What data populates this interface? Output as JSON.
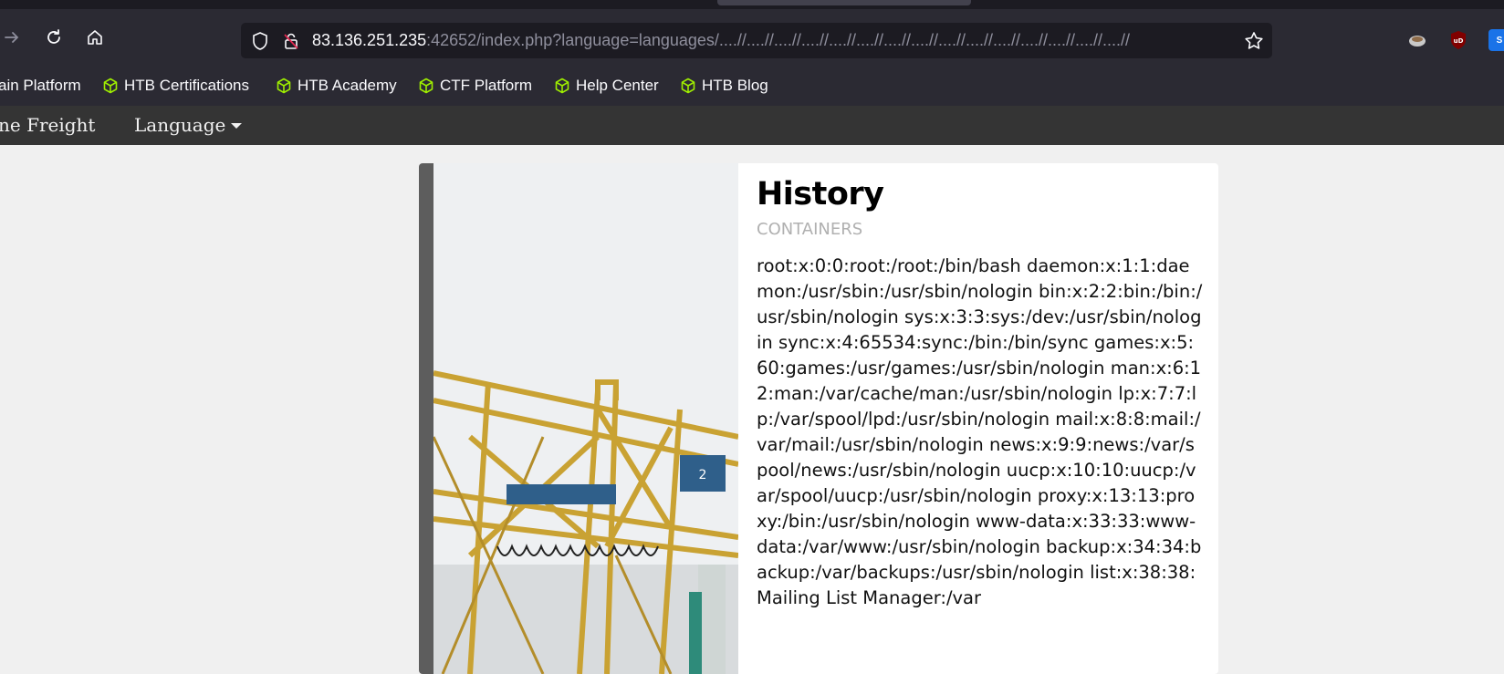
{
  "browser": {
    "url_host": "83.136.251.235",
    "url_rest": ":42652/index.php?language=languages/....//....//....//....//....//....//....//....//....//....//....//....//....//....//....//",
    "extensions": [
      "tracker-icon",
      "ublock-icon",
      "s-icon"
    ]
  },
  "bookmarks": [
    {
      "label": "ain Platform",
      "icon": "none"
    },
    {
      "label": "HTB Certifications",
      "icon": "cube-icon"
    },
    {
      "label": "HTB Academy",
      "icon": "cube-icon"
    },
    {
      "label": "CTF Platform",
      "icon": "cube-icon"
    },
    {
      "label": "Help Center",
      "icon": "cube-icon"
    },
    {
      "label": "HTB Blog",
      "icon": "cube-icon"
    }
  ],
  "site": {
    "brand": "ne Freight",
    "language_label": "Language"
  },
  "card": {
    "title": "History",
    "subtitle": "CONTAINERS",
    "body": "root:x:0:0:root:/root:/bin/bash daemon:x:1:1:daemon:/usr/sbin:/usr/sbin/nologin bin:x:2:2:bin:/bin:/usr/sbin/nologin sys:x:3:3:sys:/dev:/usr/sbin/nologin sync:x:4:65534:sync:/bin:/bin/sync games:x:5:60:games:/usr/games:/usr/sbin/nologin man:x:6:12:man:/var/cache/man:/usr/sbin/nologin lp:x:7:7:lp:/var/spool/lpd:/usr/sbin/nologin mail:x:8:8:mail:/var/mail:/usr/sbin/nologin news:x:9:9:news:/var/spool/news:/usr/sbin/nologin uucp:x:10:10:uucp:/var/spool/uucp:/usr/sbin/nologin proxy:x:13:13:proxy:/bin:/usr/sbin/nologin www-data:x:33:33:www-data:/var/www:/usr/sbin/nologin backup:x:34:34:backup:/var/backups:/usr/sbin/nologin list:x:38:38:Mailing List Manager:/var"
  },
  "colors": {
    "accent_green": "#9fef00",
    "ublock_red": "#800000"
  }
}
